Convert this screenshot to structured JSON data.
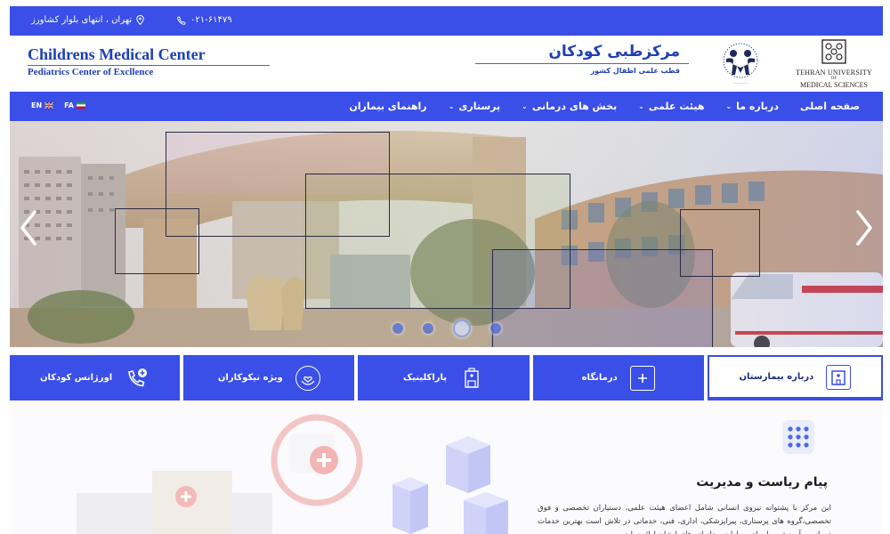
{
  "topbar": {
    "address": "تهران ، انتهای بلوار کشاورز",
    "phone": "۰۲۱-۶۱۴۷۹"
  },
  "header": {
    "en_title": "Childrens Medical Center",
    "en_subtitle": "Pediatrics Center of Excllence",
    "fa_title": "مرکزطبی کودکان",
    "fa_subtitle": "قطب علمی اطفال کشور",
    "university_logo_text": [
      "TEHRAN UNIVERSITY",
      "OF",
      "MEDICAL SCIENCES"
    ]
  },
  "nav": {
    "items": [
      {
        "label": "صفحه اصلی",
        "has_dropdown": false
      },
      {
        "label": "درباره ما",
        "has_dropdown": true
      },
      {
        "label": "هیئت علمی",
        "has_dropdown": true
      },
      {
        "label": "بخش های درمانی",
        "has_dropdown": true
      },
      {
        "label": "پرستاری",
        "has_dropdown": true
      },
      {
        "label": "راهنمای بیماران",
        "has_dropdown": false
      }
    ],
    "languages": [
      {
        "code": "EN",
        "flag": "uk"
      },
      {
        "code": "FA",
        "flag": "iran"
      }
    ]
  },
  "slider": {
    "slide_count": 4,
    "active_slide": 3
  },
  "quick_links": [
    {
      "label": "درباره بیمارستان",
      "icon": "hospital-building-icon",
      "active": true
    },
    {
      "label": "درمانگاه",
      "icon": "plus-square-icon",
      "active": false
    },
    {
      "label": "پاراکلینیک",
      "icon": "clinic-building-icon",
      "active": false
    },
    {
      "label": "ویژه نیکوکاران",
      "icon": "heart-hands-icon",
      "active": false
    },
    {
      "label": "اورژانس کودکان",
      "icon": "phone-plus-icon",
      "active": false
    }
  ],
  "management": {
    "title": "پیام ریاست و مدیریت",
    "body": "این مرکز با پشتوانه نیروی انسانی شامل اعضای هیئت علمی، دستیاران تخصصی و فوق تخصصی،گروه های پرستاری، پیراپزشکی، اداری، فنی، خدماتی در تلاش است بهترین خدمات درمانی و آموزشی را برای بیماران و خانواده های ایشان ارائه نماید"
  },
  "colors": {
    "primary": "#3a4ee8",
    "title_blue": "#1e3fb3"
  }
}
